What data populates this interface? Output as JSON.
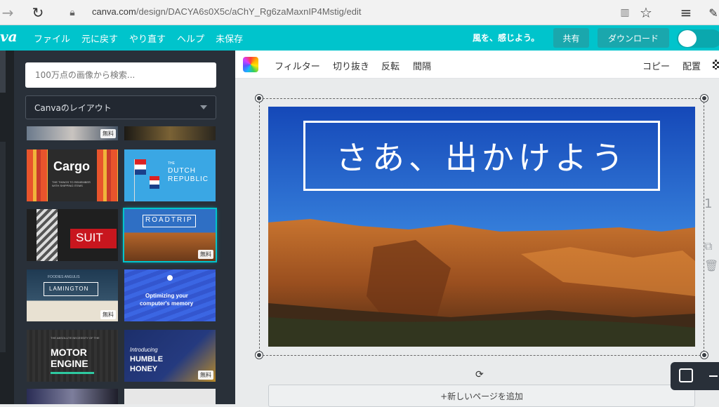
{
  "browser": {
    "url_domain": "canva.com",
    "url_path": "/design/DACYA6s0X5c/aChY_Rg6zaMaxnIP4Mstig/edit",
    "icons": [
      "forward-icon",
      "refresh-icon",
      "lock-icon",
      "reading-view-icon",
      "favorite-star-icon",
      "hub-icon",
      "web-note-icon"
    ]
  },
  "canva": {
    "logo": "va",
    "menu": [
      "ファイル",
      "元に戻す",
      "やり直す",
      "ヘルプ",
      "未保存"
    ],
    "tagline": "風を、感じよう。",
    "share_label": "共有",
    "download_label": "ダウンロード",
    "brand_color": "#00c4cc"
  },
  "panel": {
    "search_placeholder": "100万点の画像から検索...",
    "layout_select": "Canvaのレイアウト",
    "free_badge": "無料",
    "thumbs": {
      "cargo": "Cargo",
      "cargo_sub": "THE THINGS TO REMEMBER WITH SHIPPING ITEMS",
      "dutch_the": "THE",
      "dutch_1": "DUTCH",
      "dutch_2": "REPUBLIC",
      "suit": "SUIT",
      "roadtrip": "ROADTRIP",
      "lamington_top": "FOODIES ANGULIS",
      "lamington": "LAMINGTON",
      "optimize_1": "Optimizing your",
      "optimize_2": "computer's memory",
      "motor_top": "THE ABSOLUTE NECESSITY OF THE",
      "motor_1": "MOTOR",
      "motor_2": "ENGINE",
      "honey_intro": "Introducing",
      "honey_1": "HUMBLE",
      "honey_2": "HONEY"
    }
  },
  "toolbar": {
    "tools": [
      "フィルター",
      "切り抜き",
      "反転",
      "間隔"
    ],
    "copy": "コピー",
    "arrange": "配置"
  },
  "canvas": {
    "title": "さあ、出かけよう",
    "add_page": "+新しいページを追加",
    "right_number": "1"
  }
}
